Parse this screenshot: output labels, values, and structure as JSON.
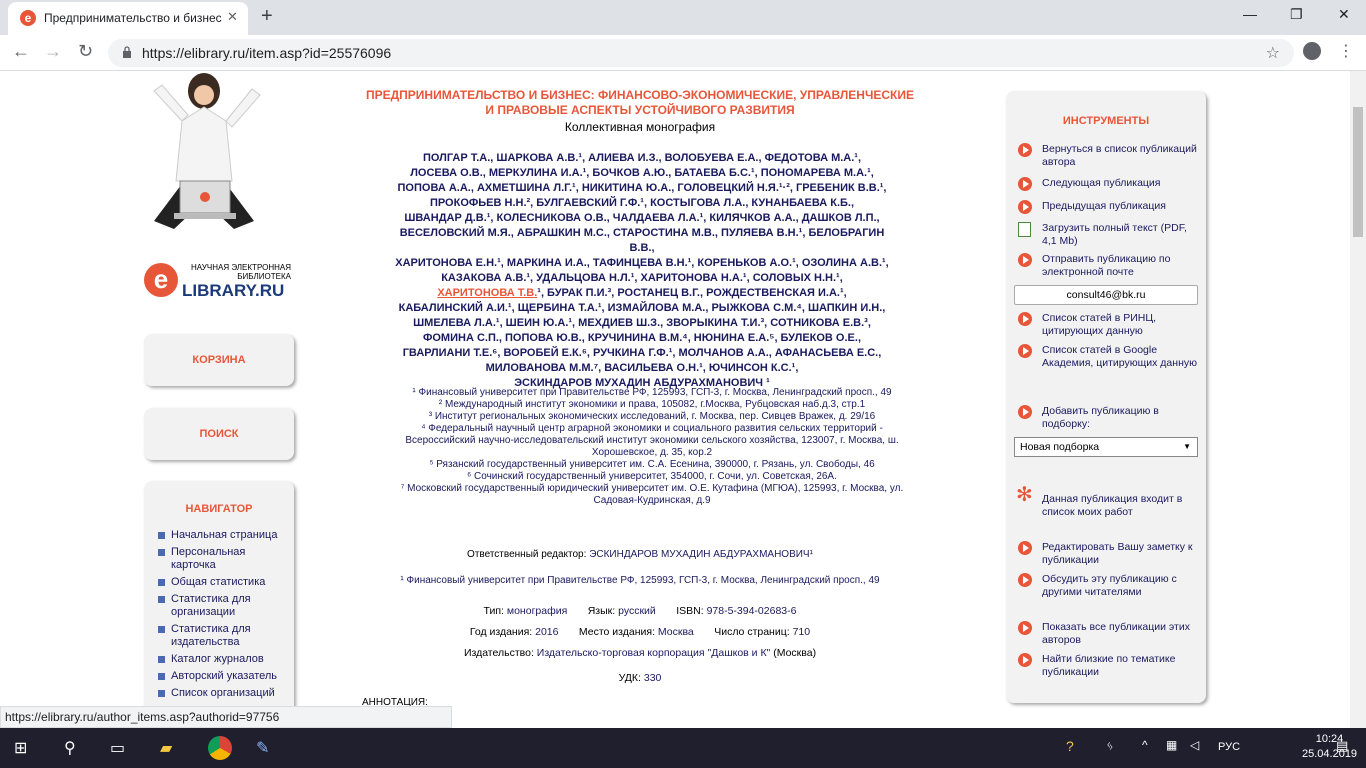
{
  "browser": {
    "tab_title": "Предпринимательство и бизнес",
    "url": "https://elibrary.ru/item.asp?id=25576096",
    "status_url": "https://elibrary.ru/author_items.asp?authorid=97756"
  },
  "sidebar": {
    "logo_line1": "НАУЧНАЯ ЭЛЕКТРОННАЯ",
    "logo_line2": "БИБЛИОТЕКА",
    "logo_text": "LIBRARY.RU",
    "cart": "КОРЗИНА",
    "search": "ПОИСК",
    "navigator": "НАВИГАТОР",
    "nav_items": [
      "Начальная страница",
      "Персональная карточка",
      "Общая статистика",
      "Статистика для организации",
      "Статистика для издательства",
      "Каталог журналов",
      "Авторский указатель",
      "Список организаций"
    ]
  },
  "main": {
    "title": "ПРЕДПРИНИМАТЕЛЬСТВО И БИЗНЕС: ФИНАНСОВО-ЭКОНОМИЧЕСКИЕ, УПРАВЛЕНЧЕСКИЕ И ПРАВОВЫЕ АСПЕКТЫ УСТОЙЧИВОГО РАЗВИТИЯ",
    "subtitle": "Коллективная монография",
    "authors_lines": [
      "ПОЛГАР Т.А., ШАРКОВА А.В.¹, АЛИЕВА И.З., ВОЛОБУЕВА Е.А., ФЕДОТОВА М.А.¹,",
      "ЛОСЕВА О.В., МЕРКУЛИНА И.А.¹, БОЧКОВ А.Ю., БАТАЕВА Б.С.¹, ПОНОМАРЕВА М.А.¹,",
      "ПОПОВА А.А., АХМЕТШИНА Л.Г.¹, НИКИТИНА Ю.А., ГОЛОВЕЦКИЙ Н.Я.¹·², ГРЕБЕНИК В.В.¹,",
      "ПРОКОФЬЕВ Н.Н.², БУЛГАЕВСКИЙ Г.Ф.¹, КОСТЫГОВА Л.А., КУНАНБАЕВА К.Б.,",
      "ШВАНДАР Д.В.¹, КОЛЕСНИКОВА О.В., ЧАЛДАЕВА Л.А.¹, КИЛЯЧКОВ А.А., ДАШКОВ Л.П.,",
      "ВЕСЕЛОВСКИЙ М.Я., АБРАШКИН М.С., СТАРОСТИНА М.В., ПУЛЯЕВА В.Н.¹, БЕЛОБРАГИН В.В.,",
      "ХАРИТОНОВА Е.Н.¹, МАРКИНА И.А., ТАФИНЦЕВА В.Н.¹, КОРЕНЬКОВ А.О.¹, ОЗОЛИНА А.В.¹,",
      "КАЗАКОВА А.В.¹, УДАЛЬЦОВА Н.Л.¹, ХАРИТОНОВА Н.А.¹, СОЛОВЫХ Н.Н.¹,"
    ],
    "authors_highlight": "ХАРИТОНОВА Т.В.",
    "authors_after_highlight": "¹, БУРАК П.И.³, РОСТАНЕЦ В.Г., РОЖДЕСТВЕНСКАЯ И.А.¹,",
    "authors_lines2": [
      "КАБАЛИНСКИЙ А.И.¹, ЩЕРБИНА Т.А.¹, ИЗМАЙЛОВА М.А., РЫЖКОВА С.М.⁴, ШАПКИН И.Н.,",
      "ШМЕЛЕВА Л.А.¹, ШЕИН Ю.А.¹, МЕХДИЕВ Ш.З., ЗВОРЫКИНА Т.И.³, СОТНИКОВА Е.В.³,",
      "ФОМИНА С.П., ПОПОВА Ю.В., КРУЧИНИНА В.М.⁴, НЮНИНА Е.А.⁵, БУЛЕКОВ О.Е.,",
      "ГВАРЛИАНИ Т.Е.⁶, ВОРОБЕЙ Е.К.⁶, РУЧКИНА Г.Ф.¹, МОЛЧАНОВ А.А., АФАНАСЬЕВА Е.С.,",
      "МИЛОВАНОВА М.М.⁷, ВАСИЛЬЕВА О.Н.¹, ЮЧИНСОН К.С.¹,",
      "ЭСКИНДАРОВ МУХАДИН АБДУРАХМАНОВИЧ ¹"
    ],
    "affiliations": [
      "¹ Финансовый университет при Правительстве РФ, 125993, ГСП-3, г. Москва, Ленинградский просп., 49",
      "² Международный институт экономики и права, 105082, г.Москва, Рубцовская наб.д.3, стр.1",
      "³ Институт региональных экономических исследований, г. Москва, пер. Сивцев Вражек, д. 29/16",
      "⁴ Федеральный научный центр аграрной экономики и социального развития сельских территорий - Всероссийский научно-исследовательский институт экономики сельского хозяйства, 123007, г. Москва, ш. Хорошевское, д. 35, кор.2",
      "⁵ Рязанский государственный университет им. С.А. Есенина, 390000, г. Рязань, ул. Свободы, 46",
      "⁶ Сочинский государственный университет, 354000, г. Сочи, ул. Советская, 26А.",
      "⁷ Московский государственный юридический университет им. О.Е. Кутафина (МГЮА), 125993, г. Москва, ул. Садовая-Кудринская, д.9"
    ],
    "editor_label": "Ответственный редактор:",
    "editor_name": "ЭСКИНДАРОВ МУХАДИН АБДУРАХМАНОВИЧ¹",
    "editor_affil": "¹ Финансовый университет при Правительстве РФ, 125993, ГСП-3, г. Москва, Ленинградский просп., 49",
    "type_label": "Тип:",
    "type_value": "монография",
    "lang_label": "Язык:",
    "lang_value": "русский",
    "isbn_label": "ISBN:",
    "isbn_value": "978-5-394-02683-6",
    "year_label": "Год издания:",
    "year_value": "2016",
    "place_label": "Место издания:",
    "place_value": "Москва",
    "pages_label": "Число страниц:",
    "pages_value": "710",
    "publisher_label": "Издательство:",
    "publisher_value": "Издательско-торговая корпорация \"Дашков и К\"",
    "publisher_city": "(Москва)",
    "udk_label": "УДК:",
    "udk_value": "330",
    "annotation_label": "АННОТАЦИЯ:"
  },
  "tools": {
    "title": "ИНСТРУМЕНТЫ",
    "items": [
      "Вернуться в список публикаций автора",
      "Следующая публикация",
      "Предыдущая публикация",
      "Загрузить полный текст (PDF, 4,1 Mb)",
      "Отправить публикацию по электронной почте",
      "Список статей в РИНЦ, цитирующих данную",
      "Список статей в Google Академия, цитирующих данную",
      "Добавить публикацию в подборку:",
      "Данная публикация входит в список моих работ",
      "Редактировать Вашу заметку к публикации",
      "Обсудить эту публикацию с другими читателями",
      "Показать все публикации этих авторов",
      "Найти близкие по тематике публикации"
    ],
    "email": "consult46@bk.ru",
    "select_value": "Новая подборка"
  },
  "taskbar": {
    "lang": "РУС",
    "time": "10:24",
    "date": "25.04.2019"
  }
}
